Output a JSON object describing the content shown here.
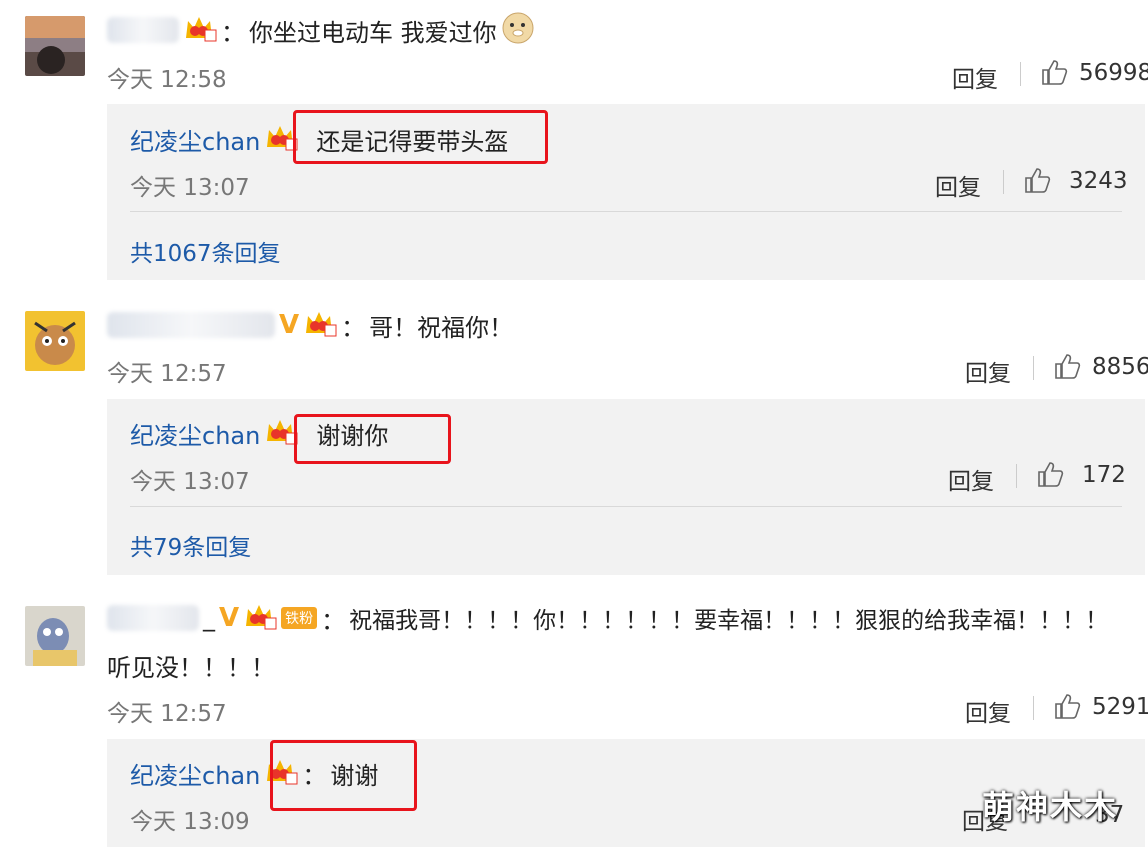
{
  "comments": [
    {
      "colon": "：",
      "text": "你坐过电动车 我爱过你",
      "time": "今天 12:58",
      "reply_label": "回复",
      "likes": "56998",
      "sub": {
        "user": "纪凌尘chan",
        "text": "还是记得要带头盔",
        "time": "今天 13:07",
        "reply_label": "回复",
        "likes": "3243",
        "more": "共1067条回复"
      }
    },
    {
      "badge": "V",
      "colon": "：",
      "text": "哥！祝福你！",
      "time": "今天 12:57",
      "reply_label": "回复",
      "likes": "8856",
      "sub": {
        "user": "纪凌尘chan",
        "text": "谢谢你",
        "time": "今天 13:07",
        "reply_label": "回复",
        "likes": "172",
        "more": "共79条回复"
      }
    },
    {
      "suffix": "_",
      "badge": "V",
      "fan_badge": "铁粉",
      "colon": "：",
      "text_line1": "祝福我哥！！！！你！！！！！！要幸福！！！！狠狠的给我幸福！！！！",
      "text_line2": "听见没！！！！",
      "time": "今天 12:57",
      "reply_label": "回复",
      "likes": "5291",
      "sub": {
        "user": "纪凌尘chan",
        "colon": "：",
        "text": "谢谢",
        "time": "今天 13:09",
        "reply_label": "回复",
        "likes": "37"
      }
    }
  ],
  "watermark": "萌神木木",
  "colors": {
    "link": "#1d5aa8",
    "highlight": "#e8141c",
    "vip": "#f5a623"
  },
  "icons": [
    "crown-icon",
    "thumbs-up-icon",
    "doge-emoji-icon",
    "v-verified-icon"
  ]
}
